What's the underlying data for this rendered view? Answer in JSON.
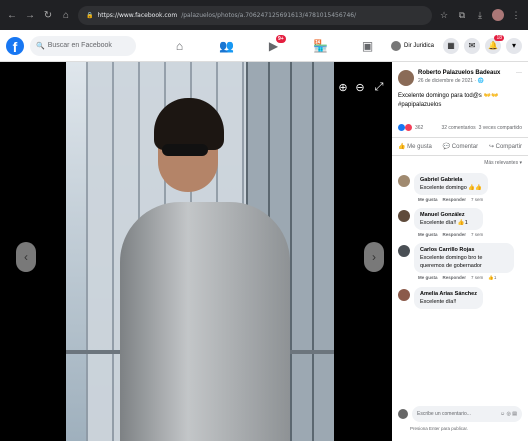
{
  "browser": {
    "url_host": "https://www.facebook.com",
    "url_path": "/palazuelos/photos/a.706247125691613/4781015456746/",
    "nav": [
      "←",
      "→",
      "↻",
      "⌂"
    ]
  },
  "fbbar": {
    "search_placeholder": "Buscar en Facebook",
    "profile_name": "Dir Juridica",
    "video_badge": "9+",
    "messenger_badge": "",
    "notif_badge": "18",
    "colors": {
      "brand": "#1877f2",
      "badge": "#e41e3f"
    }
  },
  "post": {
    "author": "Roberto Palazuelos Badeaux",
    "date": "26 de diciembre de 2021 · 🌐",
    "text": "Excelente domingo para tod@s 👐👐",
    "hashtag": "#papipalazuelos",
    "reaction_count": "362",
    "comments_count": "32 comentarios",
    "shares_count": "3 veces compartido",
    "action_like": "Me gusta",
    "action_comment": "Comentar",
    "action_share": "Compartir",
    "sort_label": "Más relevantes ▾"
  },
  "comments": [
    {
      "name": "Gabriel Gabriela",
      "text": "Excelente domingo 👍👍",
      "like": "Me gusta",
      "reply": "Responder",
      "time": "7 sem"
    },
    {
      "name": "Manuel González",
      "text": "Excelente día!!",
      "like": "Me gusta",
      "reply": "Responder",
      "time": "7 sem",
      "reacts": "1"
    },
    {
      "name": "Carlos Carrillo Rojas",
      "text": "Excelente domingo bro te queremos de gobernador",
      "like": "Me gusta",
      "reply": "Responder",
      "time": "7 sem",
      "reacts": "1"
    },
    {
      "name": "Amelia Arias Sánchez",
      "text": "Excelente día!!",
      "like": "",
      "reply": "",
      "time": ""
    }
  ],
  "composer": {
    "placeholder": "Escribe un comentario...",
    "hint": "Presiona Enter para publicar."
  },
  "viewer": {
    "zoom_in": "⊕",
    "zoom_out": "⊖",
    "fullscreen": "⤢",
    "prev": "‹",
    "next": "›"
  }
}
